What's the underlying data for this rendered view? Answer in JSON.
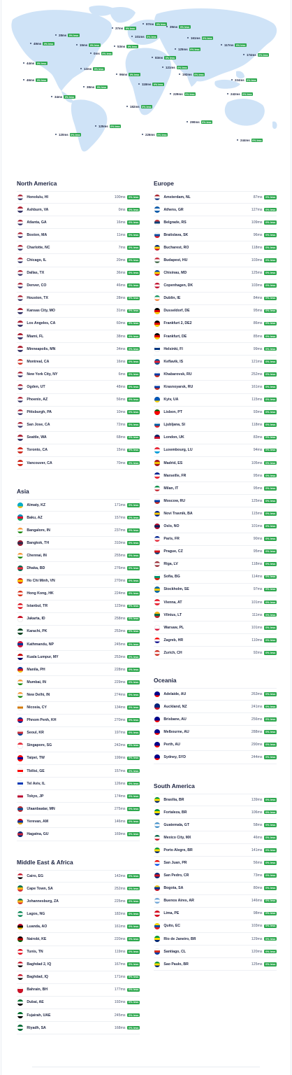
{
  "less_label": "0% less",
  "map": {
    "labels": [
      {
        "ms": "97ms"
      },
      {
        "ms": "37ms"
      },
      {
        "ms": "39ms"
      },
      {
        "ms": "28ms"
      },
      {
        "ms": "101ms"
      },
      {
        "ms": "161ms"
      },
      {
        "ms": "49ms"
      },
      {
        "ms": "15ms"
      },
      {
        "ms": "53ms"
      },
      {
        "ms": "125ms"
      },
      {
        "ms": "117ms"
      },
      {
        "ms": "0ms"
      },
      {
        "ms": "83ms"
      },
      {
        "ms": "174ms"
      },
      {
        "ms": "44ms"
      },
      {
        "ms": "12ms"
      },
      {
        "ms": "121ms"
      },
      {
        "ms": "96ms"
      },
      {
        "ms": "192ms"
      },
      {
        "ms": "224ms"
      },
      {
        "ms": "46ms"
      },
      {
        "ms": "38ms"
      },
      {
        "ms": "118ms"
      },
      {
        "ms": "229ms"
      },
      {
        "ms": "242ms"
      },
      {
        "ms": "34ms"
      },
      {
        "ms": "182ms"
      },
      {
        "ms": "290ms"
      },
      {
        "ms": "125ms"
      },
      {
        "ms": "120ms"
      },
      {
        "ms": "226ms"
      },
      {
        "ms": "244ms"
      }
    ]
  },
  "sections": {
    "north_america": {
      "title": "North America",
      "rows": [
        {
          "city": "Honolulu, HI",
          "ms": "100ms",
          "flag": "us"
        },
        {
          "city": "Ashburn, VA",
          "ms": "0ms",
          "flag": "us"
        },
        {
          "city": "Atlanta, GA",
          "ms": "16ms",
          "flag": "us"
        },
        {
          "city": "Boston, MA",
          "ms": "11ms",
          "flag": "us"
        },
        {
          "city": "Charlotte, NC",
          "ms": "7ms",
          "flag": "us"
        },
        {
          "city": "Chicago, IL",
          "ms": "20ms",
          "flag": "us"
        },
        {
          "city": "Dallas, TX",
          "ms": "36ms",
          "flag": "us"
        },
        {
          "city": "Denver, CO",
          "ms": "46ms",
          "flag": "us"
        },
        {
          "city": "Houston, TX",
          "ms": "28ms",
          "flag": "us"
        },
        {
          "city": "Kansas City, MO",
          "ms": "31ms",
          "flag": "us"
        },
        {
          "city": "Los Angeles, CA",
          "ms": "60ms",
          "flag": "us"
        },
        {
          "city": "Miami, FL",
          "ms": "38ms",
          "flag": "us"
        },
        {
          "city": "Minneapolis, MN",
          "ms": "34ms",
          "flag": "us"
        },
        {
          "city": "Montreal, CA",
          "ms": "16ms",
          "flag": "ca"
        },
        {
          "city": "New York City, NY",
          "ms": "6ms",
          "flag": "us"
        },
        {
          "city": "Ogden, UT",
          "ms": "48ms",
          "flag": "us"
        },
        {
          "city": "Phoenix, AZ",
          "ms": "56ms",
          "flag": "us"
        },
        {
          "city": "Pittsburgh, PA",
          "ms": "10ms",
          "flag": "us"
        },
        {
          "city": "San Jose, CA",
          "ms": "72ms",
          "flag": "us"
        },
        {
          "city": "Seattle, WA",
          "ms": "68ms",
          "flag": "us"
        },
        {
          "city": "Toronto, CA",
          "ms": "15ms",
          "flag": "ca"
        },
        {
          "city": "Vancouver, CA",
          "ms": "70ms",
          "flag": "ca"
        }
      ]
    },
    "asia": {
      "title": "Asia",
      "rows": [
        {
          "city": "Almaty, KZ",
          "ms": "171ms",
          "flag": "kz"
        },
        {
          "city": "Baku, AZ",
          "ms": "157ms",
          "flag": "az"
        },
        {
          "city": "Bangalore, IN",
          "ms": "237ms",
          "flag": "in"
        },
        {
          "city": "Bangkok, TH",
          "ms": "310ms",
          "flag": "th"
        },
        {
          "city": "Chennai, IN",
          "ms": "255ms",
          "flag": "in"
        },
        {
          "city": "Dhaka, BD",
          "ms": "276ms",
          "flag": "bd"
        },
        {
          "city": "Ho Chi Minh, VN",
          "ms": "270ms",
          "flag": "vn"
        },
        {
          "city": "Hong Kong, HK",
          "ms": "224ms",
          "flag": "hk"
        },
        {
          "city": "Istanbul, TR",
          "ms": "123ms",
          "flag": "tr"
        },
        {
          "city": "Jakarta, ID",
          "ms": "258ms",
          "flag": "id"
        },
        {
          "city": "Karachi, PK",
          "ms": "253ms",
          "flag": "pk"
        },
        {
          "city": "Kathmandu, NP",
          "ms": "245ms",
          "flag": "np"
        },
        {
          "city": "Kuala Lumpur, MY",
          "ms": "253ms",
          "flag": "my"
        },
        {
          "city": "Manila, PH",
          "ms": "228ms",
          "flag": "ph"
        },
        {
          "city": "Mumbai, IN",
          "ms": "229ms",
          "flag": "in"
        },
        {
          "city": "New Delhi, IN",
          "ms": "274ms",
          "flag": "in"
        },
        {
          "city": "Nicosia, CY",
          "ms": "134ms",
          "flag": "cy"
        },
        {
          "city": "Phnom Penh, KH",
          "ms": "270ms",
          "flag": "kh"
        },
        {
          "city": "Seoul, KR",
          "ms": "197ms",
          "flag": "kr"
        },
        {
          "city": "Singapore, SG",
          "ms": "242ms",
          "flag": "sg"
        },
        {
          "city": "Taipei, TW",
          "ms": "199ms",
          "flag": "tw"
        },
        {
          "city": "Tbilisi, GE",
          "ms": "157ms",
          "flag": "ge"
        },
        {
          "city": "Tel Aviv, IL",
          "ms": "126ms",
          "flag": "il"
        },
        {
          "city": "Tokyo, JP",
          "ms": "174ms",
          "flag": "jp"
        },
        {
          "city": "Ulaanbaatar, MN",
          "ms": "275ms",
          "flag": "mn"
        },
        {
          "city": "Yerevan, AM",
          "ms": "146ms",
          "flag": "am"
        },
        {
          "city": "Hagatna, GU",
          "ms": "169ms",
          "flag": "gu"
        }
      ]
    },
    "mea": {
      "title": "Middle East & Africa",
      "rows": [
        {
          "city": "Cairo, EG",
          "ms": "142ms",
          "flag": "eg"
        },
        {
          "city": "Cape Town, SA",
          "ms": "252ms",
          "flag": "za"
        },
        {
          "city": "Johannesburg, ZA",
          "ms": "225ms",
          "flag": "za"
        },
        {
          "city": "Lagos, NG",
          "ms": "182ms",
          "flag": "ng"
        },
        {
          "city": "Luanda, AO",
          "ms": "161ms",
          "flag": "ao"
        },
        {
          "city": "Nairobi, KE",
          "ms": "220ms",
          "flag": "ke"
        },
        {
          "city": "Tunis, TN",
          "ms": "119ms",
          "flag": "tn"
        },
        {
          "city": "Baghdad 2, IQ",
          "ms": "167ms",
          "flag": "iq"
        },
        {
          "city": "Baghdad, IQ",
          "ms": "171ms",
          "flag": "iq"
        },
        {
          "city": "Bahrain, BH",
          "ms": "177ms",
          "flag": "bh"
        },
        {
          "city": "Dubai, AE",
          "ms": "192ms",
          "flag": "ae"
        },
        {
          "city": "Fujairah, UAE",
          "ms": "245ms",
          "flag": "ae"
        },
        {
          "city": "Riyadh, SA",
          "ms": "168ms",
          "flag": "sa"
        }
      ]
    },
    "europe": {
      "title": "Europe",
      "rows": [
        {
          "city": "Amsterdam, NL",
          "ms": "87ms",
          "flag": "nl"
        },
        {
          "city": "Athens, GR",
          "ms": "127ms",
          "flag": "gr"
        },
        {
          "city": "Belgrade, RS",
          "ms": "109ms",
          "flag": "rs"
        },
        {
          "city": "Bratislava, SK",
          "ms": "96ms",
          "flag": "sk"
        },
        {
          "city": "Bucharest, RO",
          "ms": "118ms",
          "flag": "ro"
        },
        {
          "city": "Budapest, HU",
          "ms": "103ms",
          "flag": "hu"
        },
        {
          "city": "Chisinau, MD",
          "ms": "125ms",
          "flag": "md"
        },
        {
          "city": "Copenhagen, DK",
          "ms": "103ms",
          "flag": "dk"
        },
        {
          "city": "Dublin, IE",
          "ms": "84ms",
          "flag": "ie"
        },
        {
          "city": "Dusseldorf, DE",
          "ms": "95ms",
          "flag": "de"
        },
        {
          "city": "Frankfurt 2, DE2",
          "ms": "86ms",
          "flag": "de"
        },
        {
          "city": "Frankfurt, DE",
          "ms": "85ms",
          "flag": "de"
        },
        {
          "city": "Helsinki, FI",
          "ms": "99ms",
          "flag": "fi"
        },
        {
          "city": "Keflavik, IS",
          "ms": "121ms",
          "flag": "is"
        },
        {
          "city": "Khabarovsk, RU",
          "ms": "252ms",
          "flag": "ru"
        },
        {
          "city": "Krasnoyarsk, RU",
          "ms": "161ms",
          "flag": "ru"
        },
        {
          "city": "Kyiv, UA",
          "ms": "115ms",
          "flag": "ua"
        },
        {
          "city": "Lisbon, PT",
          "ms": "93ms",
          "flag": "pt"
        },
        {
          "city": "Ljubljana, SI",
          "ms": "118ms",
          "flag": "si"
        },
        {
          "city": "London, UK",
          "ms": "83ms",
          "flag": "uk"
        },
        {
          "city": "Luxembourg, LU",
          "ms": "94ms",
          "flag": "lu"
        },
        {
          "city": "Madrid, ES",
          "ms": "105ms",
          "flag": "es"
        },
        {
          "city": "Marseille, FR",
          "ms": "95ms",
          "flag": "fr"
        },
        {
          "city": "Milan, IT",
          "ms": "95ms",
          "flag": "it"
        },
        {
          "city": "Moscow, RU",
          "ms": "125ms",
          "flag": "ru"
        },
        {
          "city": "Novi Travnik, BA",
          "ms": "115ms",
          "flag": "ba"
        },
        {
          "city": "Oslo, NO",
          "ms": "101ms",
          "flag": "no"
        },
        {
          "city": "Paris, FR",
          "ms": "90ms",
          "flag": "fr"
        },
        {
          "city": "Prague, CZ",
          "ms": "95ms",
          "flag": "cz"
        },
        {
          "city": "Riga, LV",
          "ms": "118ms",
          "flag": "lv"
        },
        {
          "city": "Sofia, BG",
          "ms": "114ms",
          "flag": "bg"
        },
        {
          "city": "Stockholm, SE",
          "ms": "97ms",
          "flag": "se"
        },
        {
          "city": "Vienna, AT",
          "ms": "101ms",
          "flag": "at"
        },
        {
          "city": "Vilnius, LT",
          "ms": "111ms",
          "flag": "lt"
        },
        {
          "city": "Warsaw, PL",
          "ms": "101ms",
          "flag": "pl"
        },
        {
          "city": "Zagreb, HR",
          "ms": "110ms",
          "flag": "hr"
        },
        {
          "city": "Zurich, CH",
          "ms": "92ms",
          "flag": "ch"
        }
      ]
    },
    "oceania": {
      "title": "Oceania",
      "rows": [
        {
          "city": "Adelaide, AU",
          "ms": "263ms",
          "flag": "au"
        },
        {
          "city": "Auckland, NZ",
          "ms": "241ms",
          "flag": "nz"
        },
        {
          "city": "Brisbane, AU",
          "ms": "256ms",
          "flag": "au"
        },
        {
          "city": "Melbourne, AU",
          "ms": "288ms",
          "flag": "au"
        },
        {
          "city": "Perth, AU",
          "ms": "290ms",
          "flag": "au"
        },
        {
          "city": "Sydney, SYD",
          "ms": "244ms",
          "flag": "au"
        }
      ]
    },
    "south_america": {
      "title": "South America",
      "rows": [
        {
          "city": "Brasilia, BR",
          "ms": "139ms",
          "flag": "br"
        },
        {
          "city": "Fortaleza, BR",
          "ms": "106ms",
          "flag": "br"
        },
        {
          "city": "Guatemala, GT",
          "ms": "58ms",
          "flag": "gt"
        },
        {
          "city": "Mexico City, MX",
          "ms": "46ms",
          "flag": "mx"
        },
        {
          "city": "Porto Alegre, BR",
          "ms": "141ms",
          "flag": "br"
        },
        {
          "city": "San Juan, PR",
          "ms": "56ms",
          "flag": "pr"
        },
        {
          "city": "San Pedro, CR",
          "ms": "73ms",
          "flag": "cr"
        },
        {
          "city": "Bogota, SA",
          "ms": "80ms",
          "flag": "co"
        },
        {
          "city": "Buenos Aires, AR",
          "ms": "146ms",
          "flag": "ar"
        },
        {
          "city": "Lima, PE",
          "ms": "98ms",
          "flag": "pe"
        },
        {
          "city": "Quito, EC",
          "ms": "103ms",
          "flag": "ec"
        },
        {
          "city": "Rio de Janeiro, BR",
          "ms": "129ms",
          "flag": "br"
        },
        {
          "city": "Santiago, CL",
          "ms": "120ms",
          "flag": "cl"
        },
        {
          "city": "Sao Paulo, BR",
          "ms": "125ms",
          "flag": "br"
        }
      ]
    }
  },
  "colors": {
    "accent_green": "#2ea84f",
    "map_land": "#cfe3f7",
    "text_dark": "#1c2340"
  }
}
